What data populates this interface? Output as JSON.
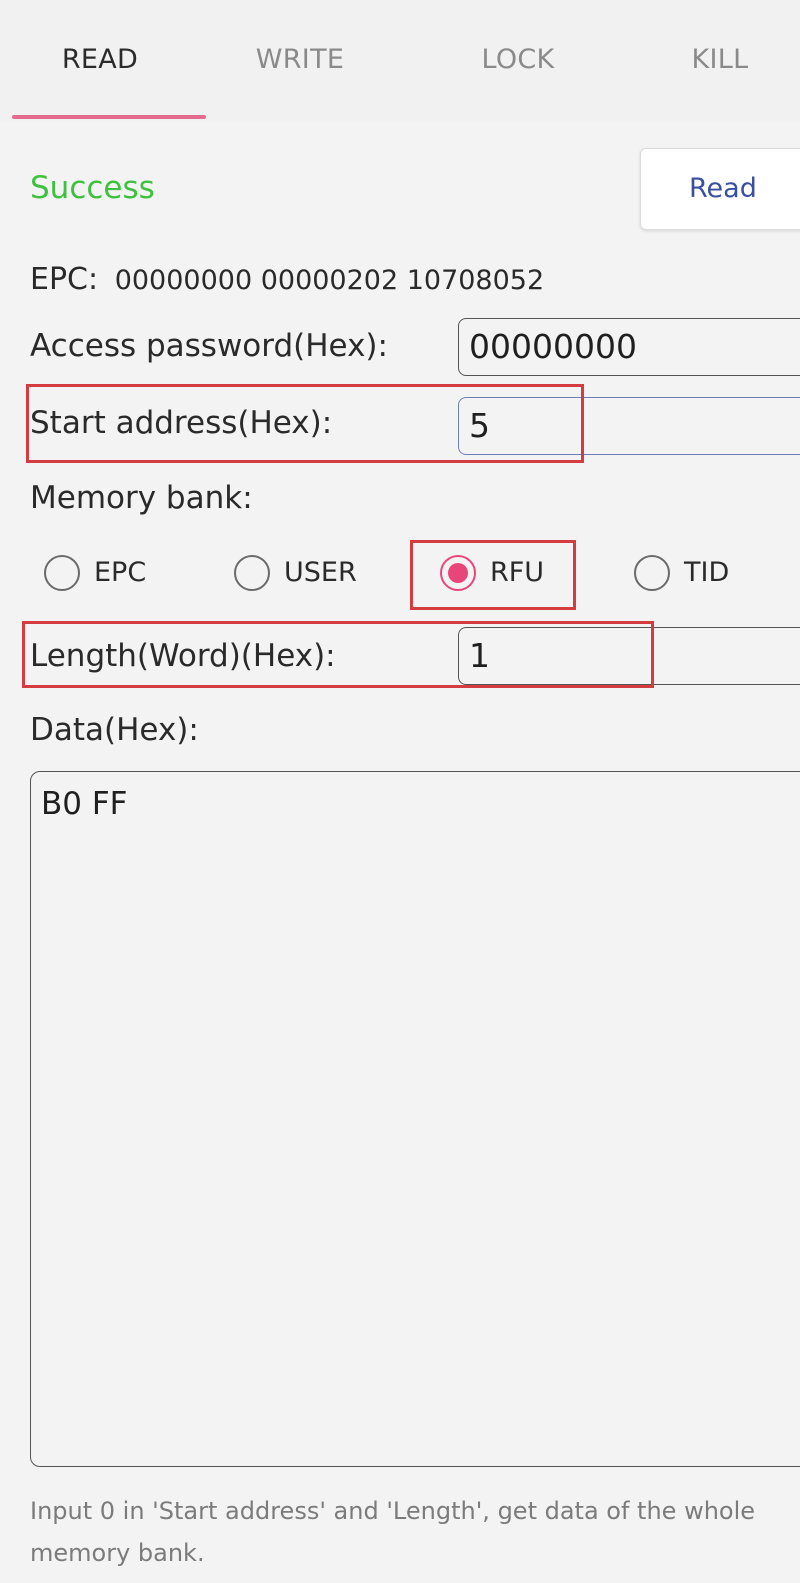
{
  "tabs": [
    {
      "label": "READ",
      "active": true
    },
    {
      "label": "WRITE",
      "active": false
    },
    {
      "label": "LOCK",
      "active": false
    },
    {
      "label": "KILL",
      "active": false
    }
  ],
  "status": {
    "text": "Success",
    "color": "#3ec13e"
  },
  "read_button": {
    "label": "Read"
  },
  "epc": {
    "label": "EPC:",
    "value": "00000000  00000202  10708052"
  },
  "access_password": {
    "label": "Access password(Hex):",
    "value": "00000000"
  },
  "start_address": {
    "label": "Start address(Hex):",
    "value": "5"
  },
  "memory_bank": {
    "label": "Memory bank:",
    "options": [
      {
        "label": "EPC",
        "checked": false
      },
      {
        "label": "USER",
        "checked": false
      },
      {
        "label": "RFU",
        "checked": true
      },
      {
        "label": "TID",
        "checked": false
      }
    ]
  },
  "length": {
    "label": "Length(Word)(Hex):",
    "value": "1"
  },
  "data": {
    "label": "Data(Hex):",
    "value": "B0 FF"
  },
  "hint": "Input 0 in 'Start address' and 'Length', get data of the whole memory bank.",
  "colors": {
    "accent": "#e8467a",
    "tab_indicator": "#e56b8f",
    "success": "#3ec13e",
    "button_text": "#3a4fa0",
    "highlight": "#d43c3f"
  }
}
